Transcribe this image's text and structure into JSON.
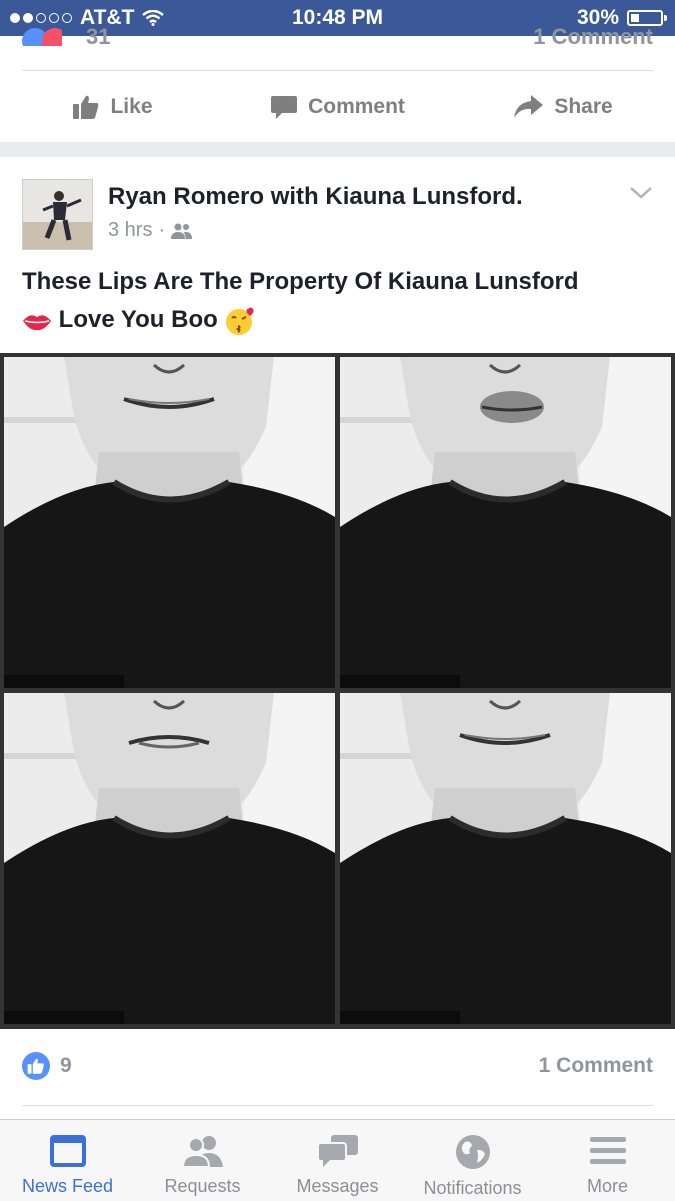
{
  "status_bar": {
    "carrier": "AT&T",
    "time": "10:48 PM",
    "battery": "30%",
    "battery_level": 0.3
  },
  "previous_post": {
    "reaction_count": "31",
    "comment_count": "1 Comment",
    "actions": [
      {
        "icon": "thumbs-up-icon",
        "label": "Like"
      },
      {
        "icon": "comment-bubble-icon",
        "label": "Comment"
      },
      {
        "icon": "share-arrow-icon",
        "label": "Share"
      }
    ]
  },
  "post": {
    "author_line": "Ryan Romero with Kiauna Lunsford.",
    "time": "3 hrs",
    "audience_icon": "friends-icon",
    "text_line1": "These Lips Are The Property Of Kiauna Lunsford",
    "text_line2": "Love You Boo",
    "emoji_before": "lips-emoji",
    "emoji_after": "kissing-face-emoji",
    "photos": [
      {
        "expression": "smile"
      },
      {
        "expression": "pout"
      },
      {
        "expression": "lip-bite"
      },
      {
        "expression": "smile"
      }
    ],
    "like_count": "9",
    "comment_count": "1 Comment"
  },
  "tabs": [
    {
      "icon": "news-feed-icon",
      "label": "News Feed",
      "active": true
    },
    {
      "icon": "requests-icon",
      "label": "Requests",
      "active": false
    },
    {
      "icon": "messages-icon",
      "label": "Messages",
      "active": false
    },
    {
      "icon": "notifications-globe-icon",
      "label": "Notifications",
      "active": false
    },
    {
      "icon": "more-menu-icon",
      "label": "More",
      "active": false
    }
  ],
  "colors": {
    "facebook_blue": "#3b5998",
    "active_tab": "#3b70d8",
    "like_blue": "#5890ff",
    "muted_text": "#90949c"
  }
}
